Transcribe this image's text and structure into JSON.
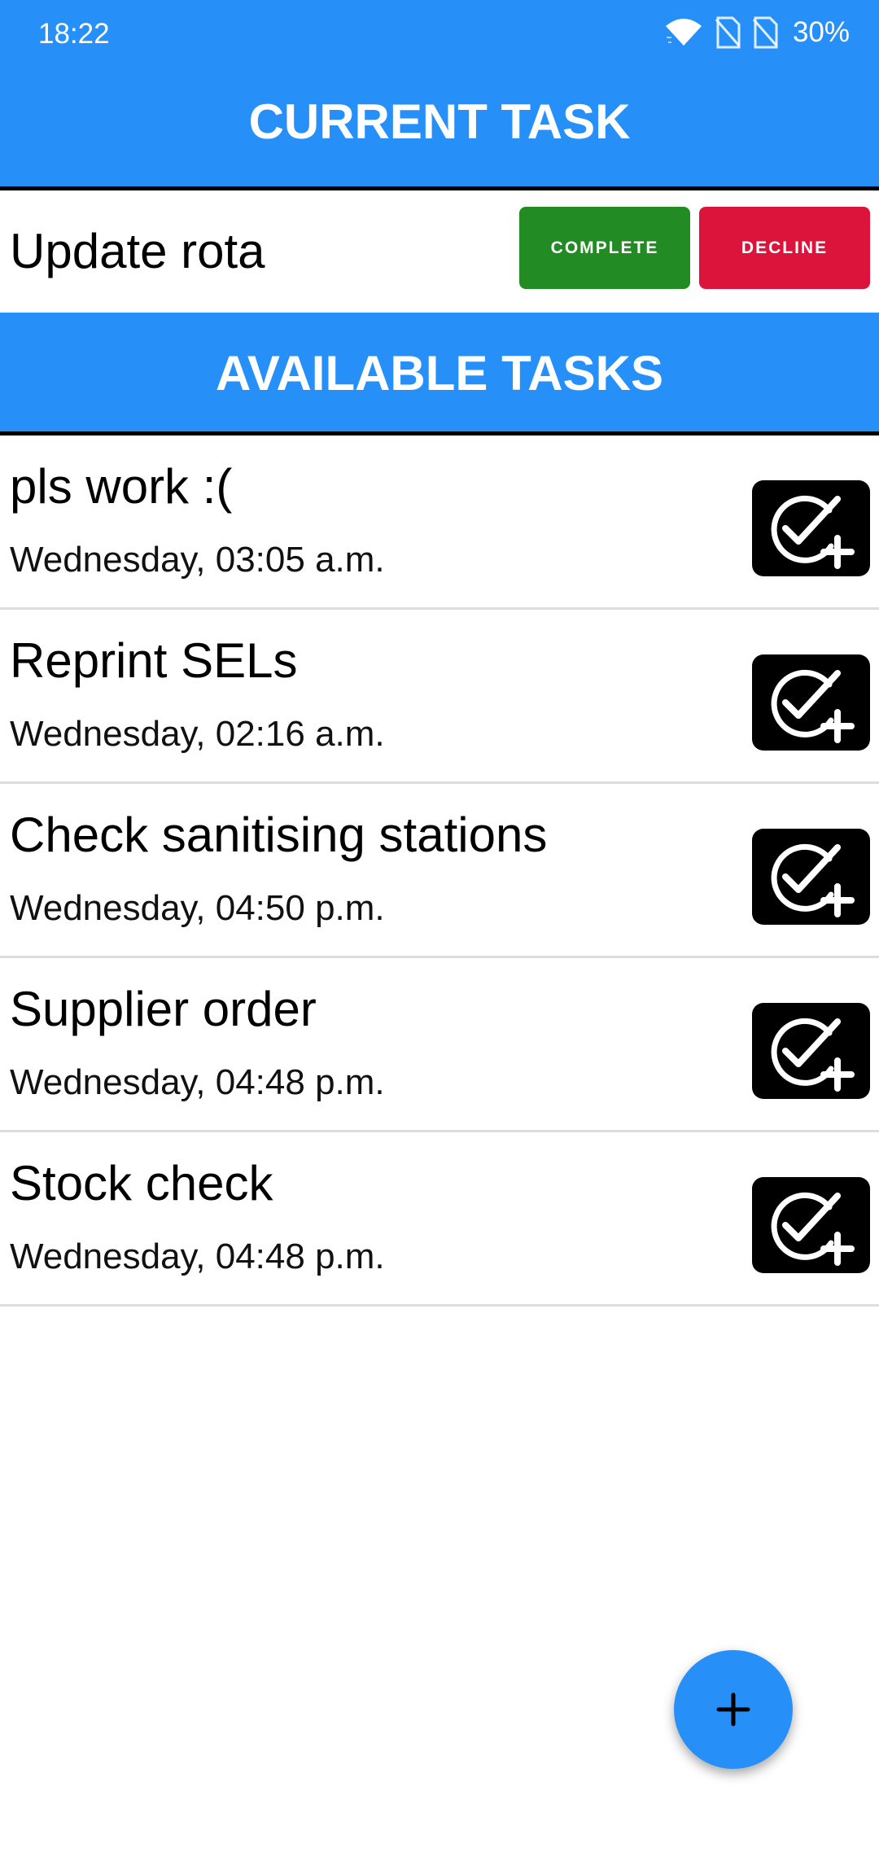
{
  "status_bar": {
    "time": "18:22",
    "battery": "30%",
    "icons": [
      "wifi-icon",
      "no-sim-icon",
      "no-sim-icon",
      "battery"
    ]
  },
  "current_section": {
    "header": "CURRENT TASK",
    "task_name": "Update rota",
    "complete_label": "COMPLETE",
    "decline_label": "DECLINE"
  },
  "available_section": {
    "header": "AVAILABLE TASKS",
    "tasks": [
      {
        "title": "pls work :(",
        "date": "Wednesday, 03:05 a.m.",
        "icon": "claim-task-icon"
      },
      {
        "title": "Reprint SELs",
        "date": "Wednesday, 02:16 a.m.",
        "icon": "claim-task-icon"
      },
      {
        "title": "Check sanitising stations",
        "date": "Wednesday, 04:50 p.m.",
        "icon": "claim-task-icon"
      },
      {
        "title": "Supplier order",
        "date": "Wednesday, 04:48 p.m.",
        "icon": "claim-task-icon"
      },
      {
        "title": "Stock check",
        "date": "Wednesday, 04:48 p.m.",
        "icon": "claim-task-icon"
      }
    ]
  },
  "fab": {
    "icon": "plus-icon"
  },
  "colors": {
    "primary": "#2790f8",
    "complete": "#238b23",
    "decline": "#dc143c",
    "divider": "#dddddd"
  }
}
